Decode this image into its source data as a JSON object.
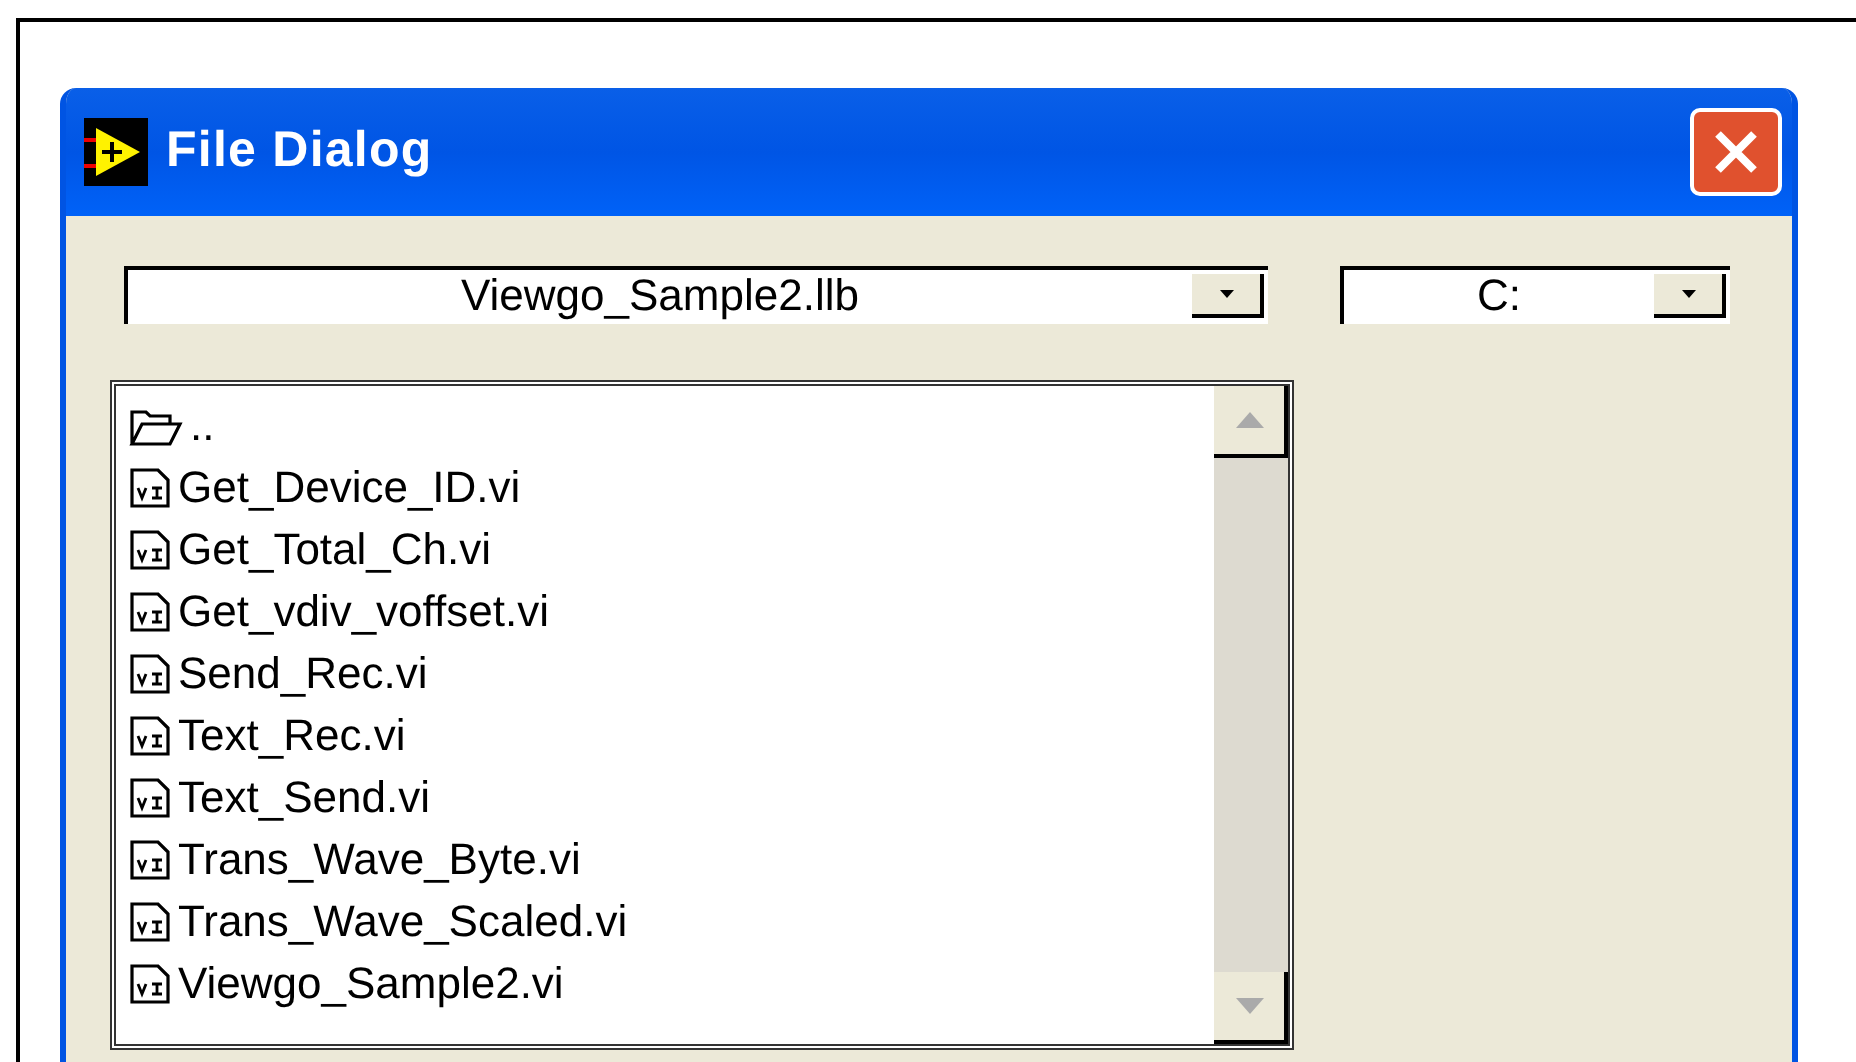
{
  "window": {
    "title": "File Dialog"
  },
  "path_dropdown": {
    "value": "Viewgo_Sample2.llb"
  },
  "drive_dropdown": {
    "value": "C:"
  },
  "files": [
    {
      "kind": "folder",
      "name": ".."
    },
    {
      "kind": "vi",
      "name": "Get_Device_ID.vi"
    },
    {
      "kind": "vi",
      "name": "Get_Total_Ch.vi"
    },
    {
      "kind": "vi",
      "name": "Get_vdiv_voffset.vi"
    },
    {
      "kind": "vi",
      "name": "Send_Rec.vi"
    },
    {
      "kind": "vi",
      "name": "Text_Rec.vi"
    },
    {
      "kind": "vi",
      "name": "Text_Send.vi"
    },
    {
      "kind": "vi",
      "name": "Trans_Wave_Byte.vi"
    },
    {
      "kind": "vi",
      "name": "Trans_Wave_Scaled.vi"
    },
    {
      "kind": "vi",
      "name": "Viewgo_Sample2.vi"
    }
  ]
}
